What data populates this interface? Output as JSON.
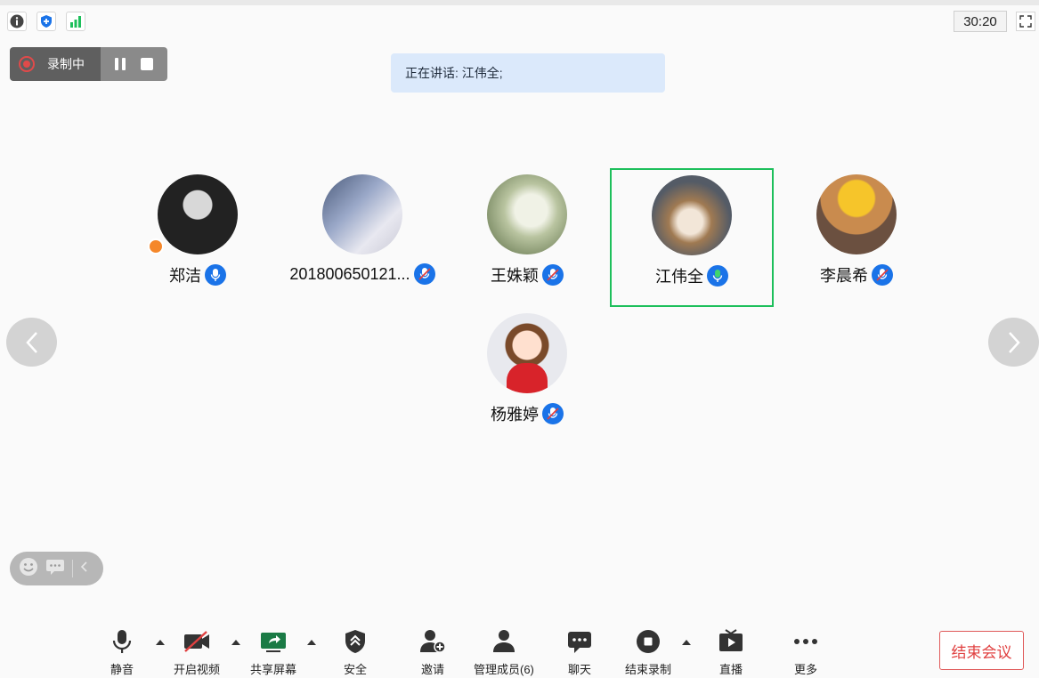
{
  "topbar": {
    "timer": "30:20"
  },
  "recording": {
    "label": "录制中"
  },
  "speaking": {
    "text": "正在讲话: 江伟全;"
  },
  "participants": [
    {
      "name": "郑洁",
      "mic": "on",
      "host": true
    },
    {
      "name": "201800650121...",
      "mic": "muted"
    },
    {
      "name": "王姝颖",
      "mic": "muted"
    },
    {
      "name": "江伟全",
      "mic": "speaking",
      "active": true
    },
    {
      "name": "李晨希",
      "mic": "muted"
    },
    {
      "name": "杨雅婷",
      "mic": "muted"
    }
  ],
  "toolbar": {
    "mute": "静音",
    "video": "开启视频",
    "share": "共享屏幕",
    "security": "安全",
    "invite": "邀请",
    "members": "管理成员(6)",
    "chat": "聊天",
    "stop_record": "结束录制",
    "live": "直播",
    "more": "更多",
    "end": "结束会议"
  },
  "colors": {
    "accent": "#1a73e8",
    "active_border": "#1dbf5b",
    "danger": "#e04040",
    "speaking_bg": "#dbe9fb"
  }
}
